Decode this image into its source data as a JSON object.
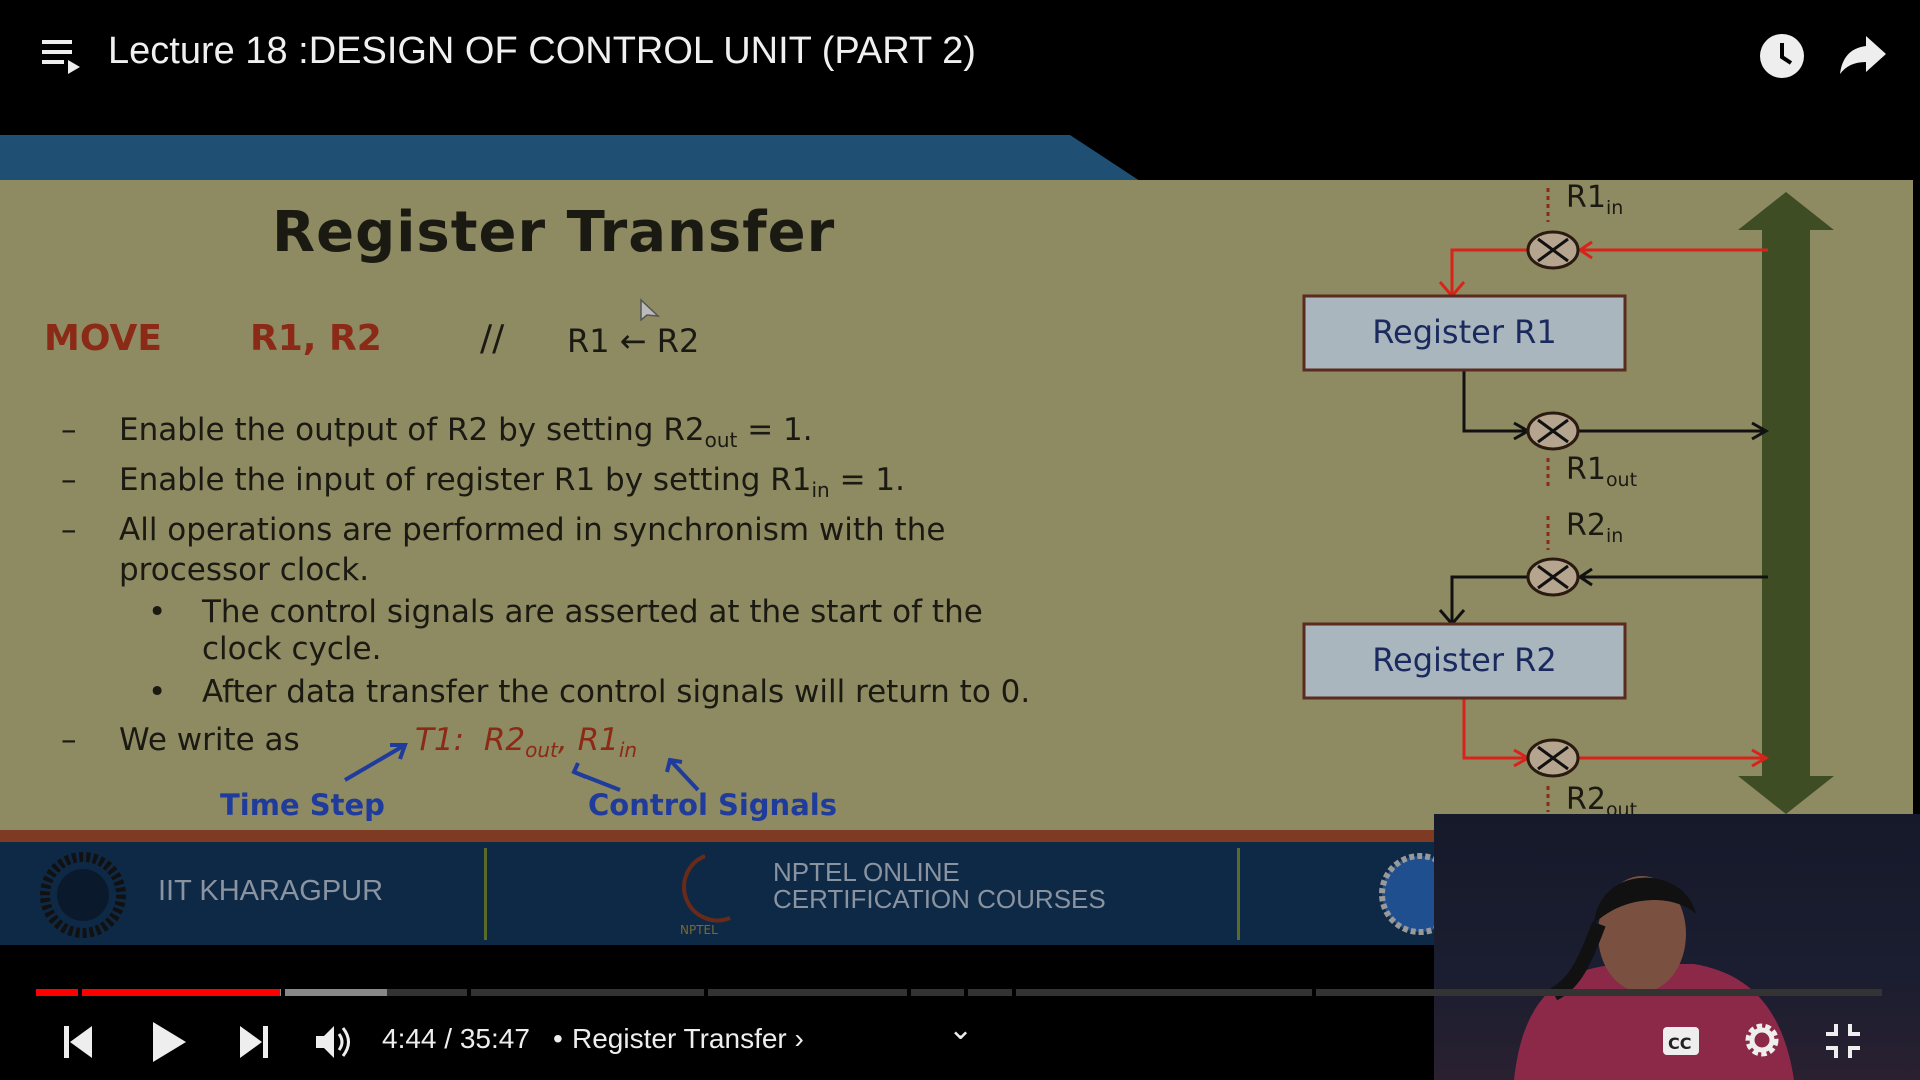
{
  "header": {
    "title": "Lecture 18 :DESIGN OF CONTROL UNIT (PART 2)",
    "icons": [
      "playlist-icon",
      "watch-later-icon",
      "share-icon"
    ]
  },
  "slide": {
    "title": "Register Transfer",
    "move": {
      "op": "MOVE",
      "args": "R1, R2",
      "comment": "//",
      "lhs": "R1",
      "arrow": "←",
      "rhs": "R2"
    },
    "bullets": [
      {
        "dash": "–",
        "pre": "Enable the output of R2 by setting R2",
        "sub": "out",
        "post": " = 1."
      },
      {
        "dash": "–",
        "pre": "Enable the input of register R1 by setting R1",
        "sub": "in",
        "post": "  = 1."
      },
      {
        "dash": "–",
        "line1": "All operations are performed in synchronism with the",
        "line2": "processor clock."
      }
    ],
    "subbullets": [
      {
        "dot": "•",
        "line1": "The control signals are asserted at the start of the",
        "line2": "clock cycle."
      },
      {
        "dot": "•",
        "line1": "After data transfer the control signals will return to 0."
      }
    ],
    "write": {
      "dash": "–",
      "text": "We write as",
      "t1": "T1:",
      "r2": "R2",
      "r2sub": "out",
      "comma": ",",
      "r1": "R1",
      "r1sub": "in",
      "time_step": "Time Step",
      "control_signals": "Control Signals"
    },
    "diagram": {
      "reg1": "Register R1",
      "reg2": "Register R2",
      "r1in": "R1",
      "r1in_sub": "in",
      "r1out": "R1",
      "r1out_sub": "out",
      "r2in": "R2",
      "r2in_sub": "in",
      "r2out": "R2",
      "r2out_sub": "out"
    },
    "footer": {
      "iit": "IIT KHARAGPUR",
      "nptel1": "NPTEL ONLINE",
      "nptel2": "CERTIFICATION COURSES",
      "nptel_logo": "NPTEL"
    }
  },
  "player": {
    "current_time": "4:44",
    "duration": "35:47",
    "separator": " / ",
    "chapter_sep": "•",
    "chapter": "Register Transfer",
    "chapter_arrow": "›",
    "progress_fraction": 0.132,
    "buffered_fraction": 0.19,
    "chapter_chevron": "⌄",
    "colors": {
      "played": "#ff0000",
      "buffered": "#888888",
      "track": "#333333"
    }
  }
}
